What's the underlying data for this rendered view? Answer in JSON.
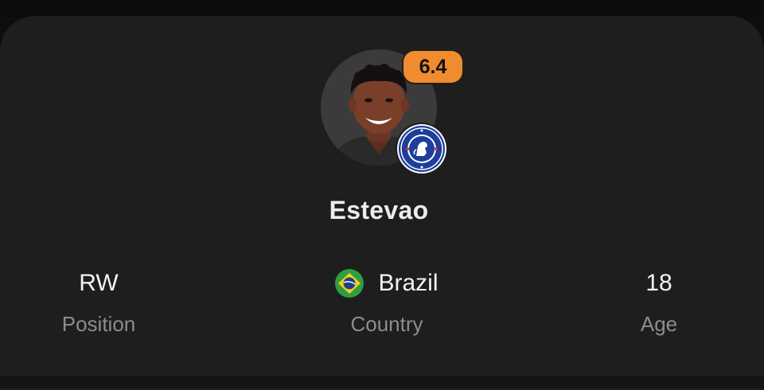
{
  "player": {
    "name": "Estevao",
    "rating": "6.4",
    "club_badge_icon": "chelsea-crest-icon",
    "avatar_icon": "player-photo"
  },
  "stats": {
    "position": {
      "value": "RW",
      "label": "Position"
    },
    "country": {
      "value": "Brazil",
      "label": "Country",
      "flag_icon": "brazil-flag-icon"
    },
    "age": {
      "value": "18",
      "label": "Age"
    }
  },
  "colors": {
    "card_bg": "#1e1e1e",
    "rating_bg": "#f08b2e",
    "label_color": "#8d8d8d",
    "club_blue": "#1d3e9a",
    "flag_green": "#2f9e41",
    "flag_yellow": "#f5d21b"
  }
}
